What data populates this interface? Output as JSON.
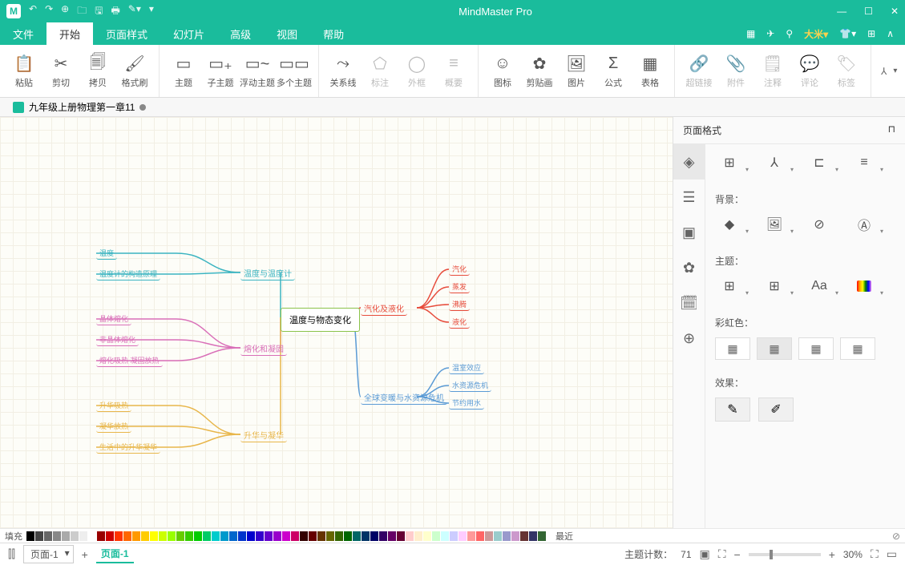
{
  "app": {
    "title": "MindMaster Pro"
  },
  "qat": [
    "↶",
    "↷",
    "⊕",
    "🗀",
    "🖫",
    "🖶",
    "✎▾",
    "▾"
  ],
  "win": [
    "—",
    "☐",
    "✕"
  ],
  "menu": {
    "items": [
      "文件",
      "开始",
      "页面样式",
      "幻灯片",
      "高级",
      "视图",
      "帮助"
    ],
    "active": 1
  },
  "menuright": {
    "user": "大米▾",
    "icons": [
      "▦",
      "✈",
      "⚲"
    ],
    "icons2": [
      "👕▾",
      "⊞",
      "∧"
    ]
  },
  "ribbon": [
    {
      "items": [
        {
          "ico": "📋",
          "lbl": "粘贴"
        },
        {
          "ico": "✂",
          "lbl": "剪切"
        },
        {
          "ico": "🗐",
          "lbl": "拷贝"
        },
        {
          "ico": "🖌",
          "lbl": "格式刷"
        }
      ]
    },
    {
      "items": [
        {
          "ico": "▭",
          "lbl": "主题"
        },
        {
          "ico": "▭₊",
          "lbl": "子主题"
        },
        {
          "ico": "▭~",
          "lbl": "浮动主题"
        },
        {
          "ico": "▭▭",
          "lbl": "多个主题"
        }
      ]
    },
    {
      "items": [
        {
          "ico": "⤳",
          "lbl": "关系线"
        },
        {
          "ico": "⬠",
          "lbl": "标注",
          "dis": true
        },
        {
          "ico": "◯",
          "lbl": "外框",
          "dis": true
        },
        {
          "ico": "≡",
          "lbl": "概要",
          "dis": true
        }
      ]
    },
    {
      "items": [
        {
          "ico": "☺",
          "lbl": "图标"
        },
        {
          "ico": "✿",
          "lbl": "剪贴画"
        },
        {
          "ico": "🖼",
          "lbl": "图片"
        },
        {
          "ico": "Σ",
          "lbl": "公式"
        },
        {
          "ico": "▦",
          "lbl": "表格"
        }
      ]
    },
    {
      "items": [
        {
          "ico": "🔗",
          "lbl": "超链接",
          "dis": true
        },
        {
          "ico": "📎",
          "lbl": "附件",
          "dis": true
        },
        {
          "ico": "🗒",
          "lbl": "注释",
          "dis": true
        },
        {
          "ico": "💬",
          "lbl": "评论",
          "dis": true
        },
        {
          "ico": "🏷",
          "lbl": "标签",
          "dis": true
        }
      ]
    }
  ],
  "ribbon_end": "⅄",
  "doc": {
    "name": "九年级上册物理第一章11"
  },
  "central": "温度与物态变化",
  "branches": {
    "left": [
      {
        "lbl": "温度与温度计",
        "color": "#3bb4c1",
        "children": [
          "温度",
          "温度计的构造原理"
        ]
      },
      {
        "lbl": "熔化和凝固",
        "color": "#d96fb8",
        "children": [
          "晶体熔化",
          "非晶体熔化",
          "熔化吸热 凝固放热"
        ]
      },
      {
        "lbl": "升华与凝华",
        "color": "#e8b64a",
        "children": [
          "升华吸热",
          "凝华放热",
          "生活中的升华凝华"
        ]
      }
    ],
    "right": [
      {
        "lbl": "汽化及液化",
        "color": "#e74c3c",
        "children": [
          "汽化",
          "蒸发",
          "沸腾",
          "液化"
        ]
      },
      {
        "lbl": "全球变暖与水资源危机",
        "color": "#5b9bd5",
        "children": [
          "温室效应",
          "水资源危机",
          "节约用水"
        ]
      }
    ]
  },
  "rightpanel": {
    "title": "页面格式",
    "sections": {
      "bg": "背景：",
      "theme": "主题：",
      "rainbow": "彩虹色：",
      "effect": "效果："
    }
  },
  "colorbar_lbl": "填充",
  "colorbar_recent": "最近",
  "status": {
    "page_sel": "页面-1",
    "page_tab": "页面-1",
    "topic_count_lbl": "主题计数：",
    "topic_count": "71",
    "zoom": "30%"
  },
  "palette": [
    "#000",
    "#444",
    "#666",
    "#888",
    "#aaa",
    "#ccc",
    "#eee",
    "#fff",
    "#900",
    "#c00",
    "#f30",
    "#f60",
    "#f90",
    "#fc0",
    "#ff0",
    "#cf0",
    "#9f0",
    "#6c0",
    "#3c0",
    "#0c0",
    "#0c6",
    "#0cc",
    "#09c",
    "#06c",
    "#03c",
    "#00c",
    "#30c",
    "#60c",
    "#90c",
    "#c0c",
    "#c06",
    "#300",
    "#600",
    "#630",
    "#660",
    "#360",
    "#060",
    "#066",
    "#036",
    "#006",
    "#306",
    "#606",
    "#603",
    "#fcc",
    "#fec",
    "#ffc",
    "#cfc",
    "#cff",
    "#ccf",
    "#fcf",
    "#f99",
    "#f66",
    "#c99",
    "#9cc",
    "#99c",
    "#c9c",
    "#633",
    "#336",
    "#363"
  ]
}
